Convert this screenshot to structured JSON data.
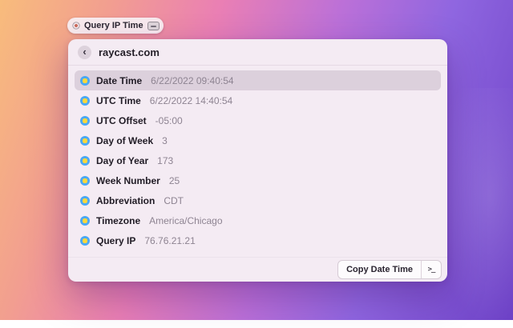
{
  "background": {
    "gradient_stops": [
      "#f8bc7c",
      "#ea7fb4",
      "#8f66e0",
      "#6d41c6"
    ]
  },
  "tooltip": {
    "label": "Query IP Time"
  },
  "window": {
    "header": {
      "back_glyph": "‹",
      "title": "raycast.com"
    },
    "rows": [
      {
        "label": "Date Time",
        "value": "6/22/2022 09:40:54",
        "selected": true
      },
      {
        "label": "UTC Time",
        "value": "6/22/2022 14:40:54",
        "selected": false
      },
      {
        "label": "UTC Offset",
        "value": "-05:00",
        "selected": false
      },
      {
        "label": "Day of Week",
        "value": "3",
        "selected": false
      },
      {
        "label": "Day of Year",
        "value": "173",
        "selected": false
      },
      {
        "label": "Week Number",
        "value": "25",
        "selected": false
      },
      {
        "label": "Abbreviation",
        "value": "CDT",
        "selected": false
      },
      {
        "label": "Timezone",
        "value": "America/Chicago",
        "selected": false
      },
      {
        "label": "Query IP",
        "value": "76.76.21.21",
        "selected": false
      }
    ],
    "footer": {
      "primary_action": "Copy Date Time",
      "terminal_glyph": ">_"
    },
    "colors": {
      "panel_bg": "#f4ebf3",
      "selected_row_bg": "#dcd0dc",
      "row_icon_outer": "#49a8f5",
      "row_icon_inner": "#ffd83a",
      "value_text": "#8e8492",
      "label_text": "#211c26"
    }
  }
}
